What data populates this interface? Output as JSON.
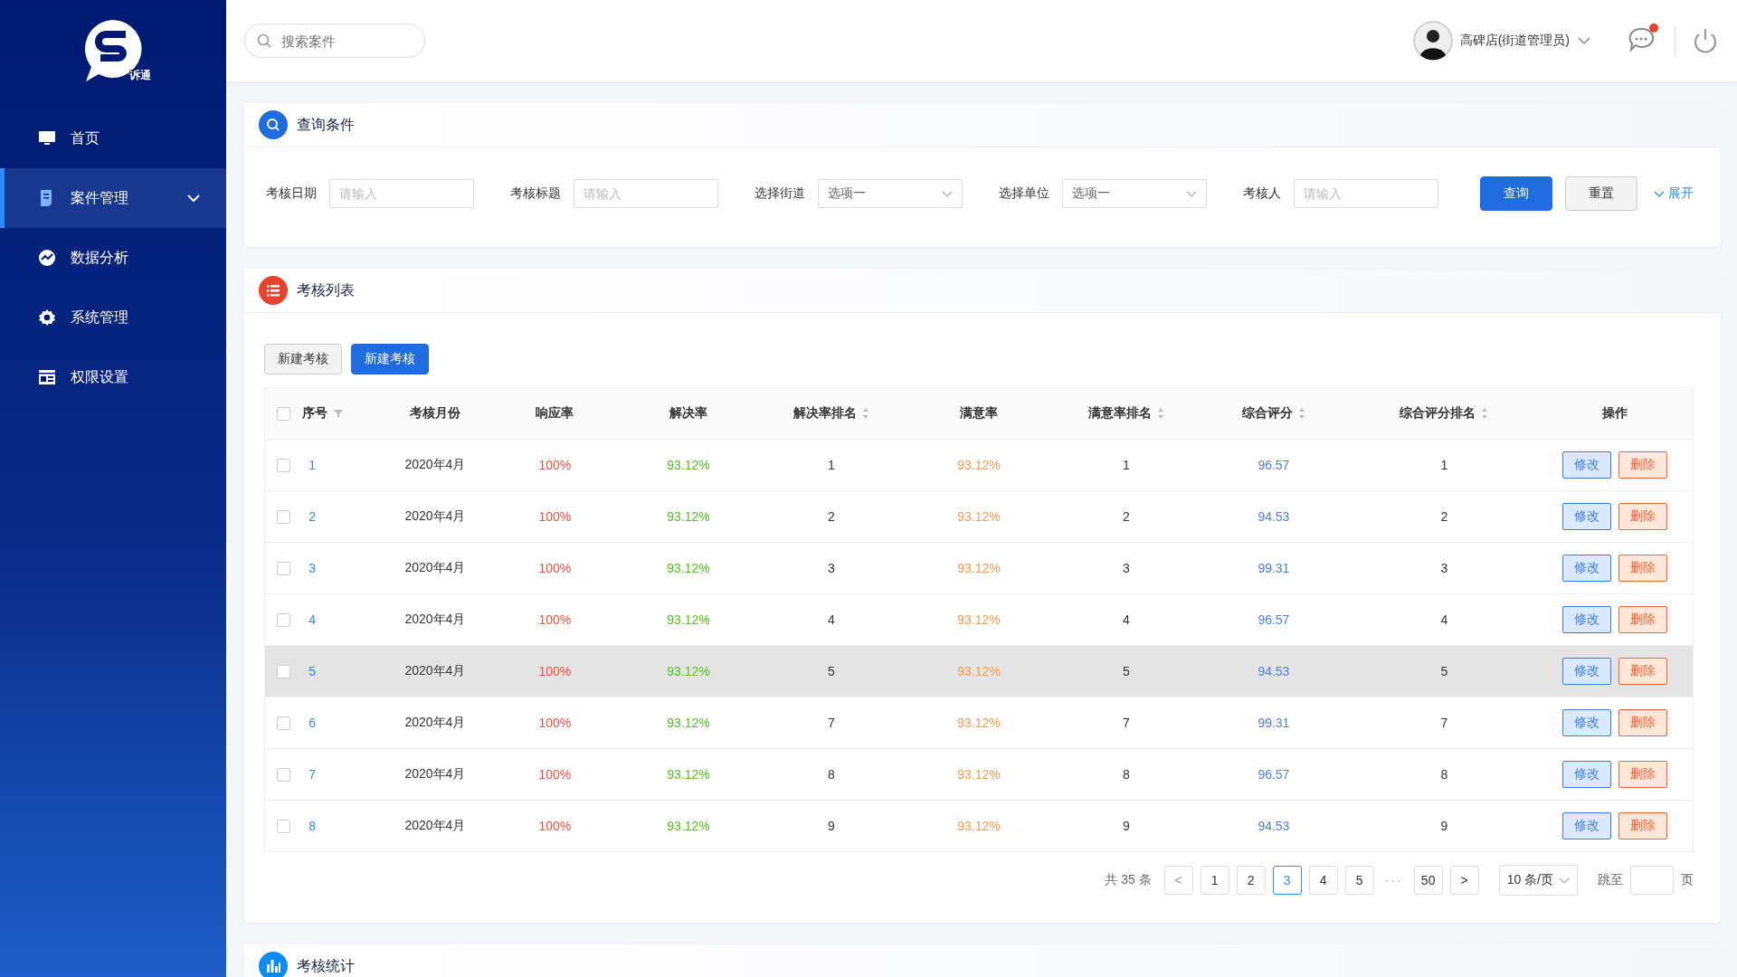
{
  "logo": {
    "text": "诉通"
  },
  "sidebar": {
    "items": [
      {
        "label": "首页",
        "selected": false,
        "expandable": false
      },
      {
        "label": "案件管理",
        "selected": true,
        "expandable": true
      },
      {
        "label": "数据分析",
        "selected": false,
        "expandable": false
      },
      {
        "label": "系统管理",
        "selected": false,
        "expandable": false
      },
      {
        "label": "权限设置",
        "selected": false,
        "expandable": false
      }
    ]
  },
  "header": {
    "search": {
      "placeholder": "搜索案件"
    },
    "user": {
      "name": "高碑店(街道管理员)"
    },
    "messages": {
      "unread": true
    }
  },
  "query_panel": {
    "title": "查询条件",
    "fields": [
      {
        "label": "考核日期",
        "kind": "input",
        "placeholder": "请输入"
      },
      {
        "label": "考核标题",
        "kind": "input",
        "placeholder": "请输入"
      },
      {
        "label": "选择街道",
        "kind": "select",
        "value": "选项一"
      },
      {
        "label": "选择单位",
        "kind": "select",
        "value": "选项一"
      },
      {
        "label": "考核人",
        "kind": "input",
        "placeholder": "请输入"
      }
    ],
    "buttons": [
      {
        "label": "查询",
        "kind": "primary"
      },
      {
        "label": "重置",
        "kind": "default"
      }
    ],
    "expand_link": "展开"
  },
  "list_panel": {
    "title": "考核列表",
    "buttons": [
      {
        "label": "新建考核",
        "kind": "default"
      },
      {
        "label": "新建考核",
        "kind": "primary"
      }
    ],
    "table": {
      "select_all": {
        "checked": false
      },
      "columns": [
        {
          "label": "序号",
          "filter": true,
          "sortable": false,
          "kind": "link"
        },
        {
          "label": "考核月份",
          "filter": false,
          "sortable": false,
          "kind": "plain"
        },
        {
          "label": "响应率",
          "filter": false,
          "sortable": false,
          "kind": "response"
        },
        {
          "label": "解决率",
          "filter": false,
          "sortable": false,
          "kind": "resolution"
        },
        {
          "label": "解决率排名",
          "filter": false,
          "sortable": true,
          "kind": "plain"
        },
        {
          "label": "满意率",
          "filter": false,
          "sortable": false,
          "kind": "satisfaction"
        },
        {
          "label": "满意率排名",
          "filter": false,
          "sortable": true,
          "kind": "plain"
        },
        {
          "label": "综合评分",
          "filter": false,
          "sortable": true,
          "kind": "score"
        },
        {
          "label": "综合评分排名",
          "filter": false,
          "sortable": true,
          "kind": "plain"
        },
        {
          "label": "操作",
          "filter": false,
          "sortable": false,
          "kind": "actions"
        }
      ],
      "rows": [
        {
          "checked": false,
          "highlighted": false,
          "cells": [
            "1",
            "2020年4月",
            "100%",
            "93.12%",
            "1",
            "93.12%",
            "1",
            "96.57",
            "1"
          ],
          "actions": [
            "修改",
            "删除"
          ]
        },
        {
          "checked": false,
          "highlighted": false,
          "cells": [
            "2",
            "2020年4月",
            "100%",
            "93.12%",
            "2",
            "93.12%",
            "2",
            "94.53",
            "2"
          ],
          "actions": [
            "修改",
            "删除"
          ]
        },
        {
          "checked": false,
          "highlighted": false,
          "cells": [
            "3",
            "2020年4月",
            "100%",
            "93.12%",
            "3",
            "93.12%",
            "3",
            "99.31",
            "3"
          ],
          "actions": [
            "修改",
            "删除"
          ]
        },
        {
          "checked": false,
          "highlighted": false,
          "cells": [
            "4",
            "2020年4月",
            "100%",
            "93.12%",
            "4",
            "93.12%",
            "4",
            "96.57",
            "4"
          ],
          "actions": [
            "修改",
            "删除"
          ]
        },
        {
          "checked": false,
          "highlighted": true,
          "cells": [
            "5",
            "2020年4月",
            "100%",
            "93.12%",
            "5",
            "93.12%",
            "5",
            "94.53",
            "5"
          ],
          "actions": [
            "修改",
            "删除"
          ]
        },
        {
          "checked": false,
          "highlighted": false,
          "cells": [
            "6",
            "2020年4月",
            "100%",
            "93.12%",
            "7",
            "93.12%",
            "7",
            "99.31",
            "7"
          ],
          "actions": [
            "修改",
            "删除"
          ]
        },
        {
          "checked": false,
          "highlighted": false,
          "cells": [
            "7",
            "2020年4月",
            "100%",
            "93.12%",
            "8",
            "93.12%",
            "8",
            "96.57",
            "8"
          ],
          "actions": [
            "修改",
            "删除"
          ]
        },
        {
          "checked": false,
          "highlighted": false,
          "cells": [
            "8",
            "2020年4月",
            "100%",
            "93.12%",
            "9",
            "93.12%",
            "9",
            "94.53",
            "9"
          ],
          "actions": [
            "修改",
            "删除"
          ]
        }
      ]
    },
    "pagination": {
      "total": "共 35 条",
      "prev": "<",
      "next": ">",
      "pages": [
        {
          "label": "1",
          "kind": "page",
          "selected": false
        },
        {
          "label": "2",
          "kind": "page",
          "selected": false
        },
        {
          "label": "3",
          "kind": "page",
          "selected": true
        },
        {
          "label": "4",
          "kind": "page",
          "selected": false
        },
        {
          "label": "5",
          "kind": "page",
          "selected": false
        },
        {
          "label": "···",
          "kind": "ellipsis"
        },
        {
          "label": "50",
          "kind": "page",
          "selected": false
        }
      ],
      "page_size": "10 条/页",
      "jump_label": "跳至",
      "jump_suffix": "页"
    }
  },
  "stats_panel": {
    "title": "考核统计"
  }
}
